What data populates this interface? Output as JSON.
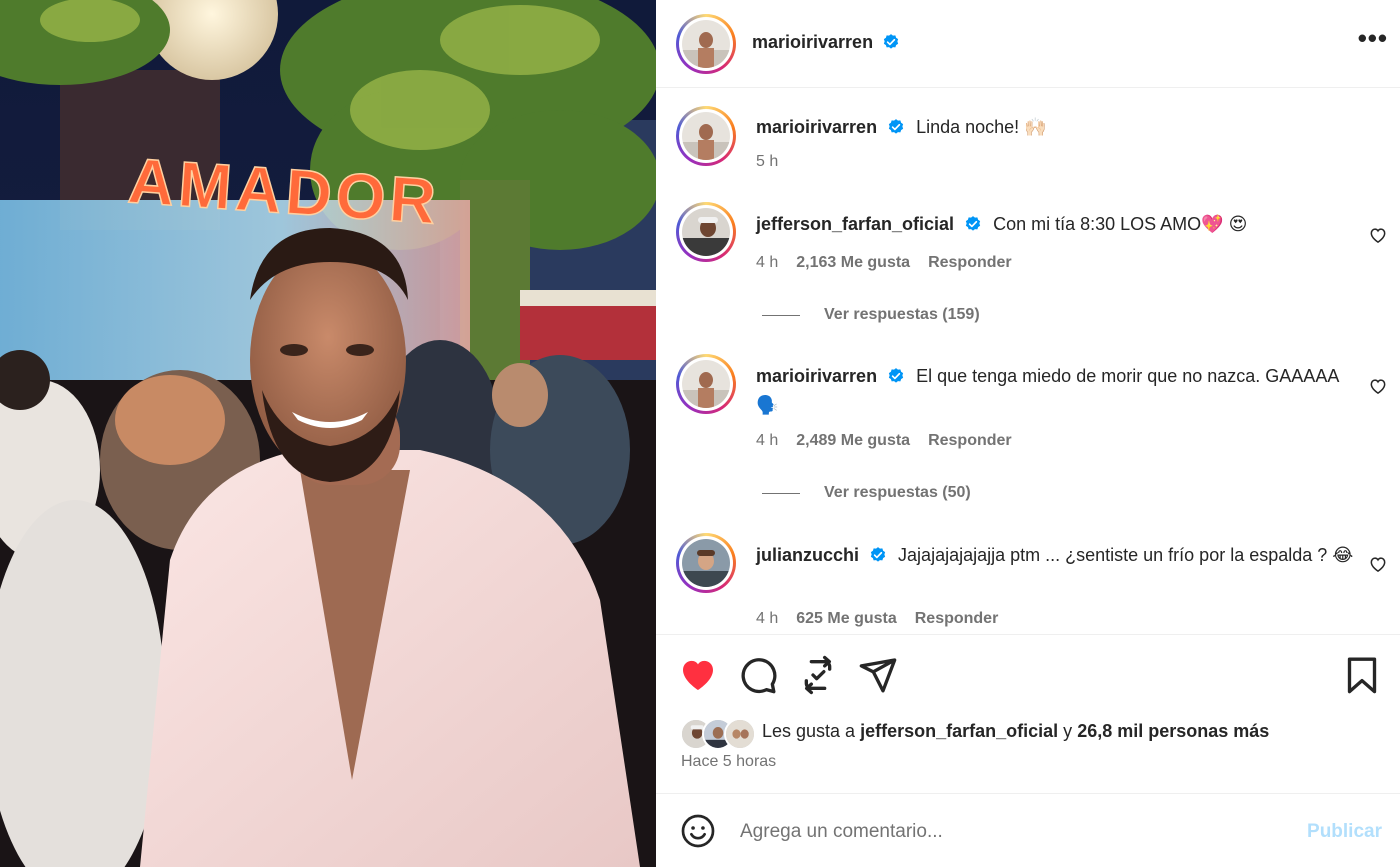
{
  "post": {
    "author": "marioirivarren",
    "sign_text": "AMADOR"
  },
  "header": {
    "username": "marioirivarren",
    "more_icon": "more-horizontal-icon"
  },
  "caption": {
    "username": "marioirivarren",
    "text": "Linda noche! 🙌🏻",
    "time": "5 h"
  },
  "comments": [
    {
      "username": "jefferson_farfan_oficial",
      "text": "Con mi tía 8:30 LOS AMO💖 😍",
      "time": "4 h",
      "likes": "2,163 Me gusta",
      "reply": "Responder",
      "replies": "Ver respuestas (159)"
    },
    {
      "username": "marioirivarren",
      "text": "El que tenga miedo de morir que no nazca. GAAAAA 🗣️",
      "time": "4 h",
      "likes": "2,489 Me gusta",
      "reply": "Responder",
      "replies": "Ver respuestas (50)"
    },
    {
      "username": "julianzucchi",
      "text": "Jajajajajajajja ptm ... ¿sentiste un frío por la espalda ? 😂",
      "time": "4 h",
      "likes": "625 Me gusta",
      "reply": "Responder"
    }
  ],
  "actions": {
    "like_icon": "heart-filled-icon",
    "comment_icon": "comment-bubble-icon",
    "repost_icon": "repost-icon",
    "share_icon": "send-icon",
    "save_icon": "bookmark-icon",
    "like_color": "#ff3040"
  },
  "likes": {
    "prefix": "Les gusta a",
    "user": "jefferson_farfan_oficial",
    "connector": "y",
    "others": "26,8 mil personas más",
    "time_ago": "Hace 5 horas"
  },
  "add_comment": {
    "placeholder": "Agrega un comentario...",
    "publish": "Publicar",
    "emoji_icon": "smiley-icon"
  },
  "colors": {
    "verified": "#0095f6",
    "publish_disabled": "#b2dffc",
    "muted": "#737373"
  }
}
